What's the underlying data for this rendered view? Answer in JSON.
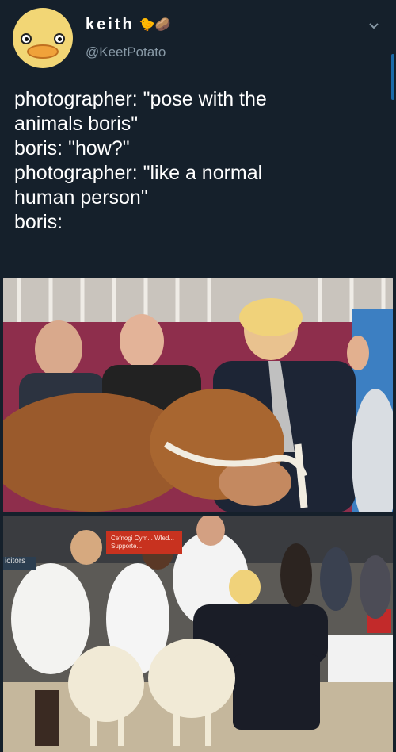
{
  "header": {
    "display_name": "keith",
    "name_emojis": "🐤🥔",
    "handle": "@KeetPotato"
  },
  "tweet": {
    "lines": [
      "photographer: \"pose with the",
      "animals boris\"",
      "boris: \"how?\"",
      "photographer: \"like a normal",
      "human person\"",
      "boris:"
    ]
  },
  "photo2": {
    "banner_text": "Cefnogi Cym... Wled... Supporte...",
    "sign_text": "icitors"
  },
  "colors": {
    "background": "#15202b",
    "handle": "#8899a6",
    "accent": "#1c6aa8"
  },
  "icons": [
    "avatar-duck-icon",
    "chevron-down-icon"
  ]
}
